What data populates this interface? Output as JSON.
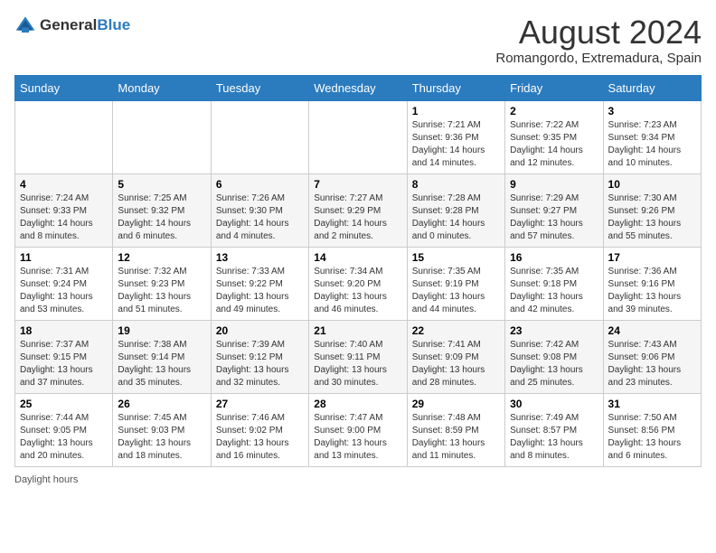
{
  "header": {
    "logo_general": "General",
    "logo_blue": "Blue",
    "main_title": "August 2024",
    "subtitle": "Romangordo, Extremadura, Spain"
  },
  "calendar": {
    "weekdays": [
      "Sunday",
      "Monday",
      "Tuesday",
      "Wednesday",
      "Thursday",
      "Friday",
      "Saturday"
    ],
    "weeks": [
      [
        {
          "day": "",
          "info": ""
        },
        {
          "day": "",
          "info": ""
        },
        {
          "day": "",
          "info": ""
        },
        {
          "day": "",
          "info": ""
        },
        {
          "day": "1",
          "info": "Sunrise: 7:21 AM\nSunset: 9:36 PM\nDaylight: 14 hours and 14 minutes."
        },
        {
          "day": "2",
          "info": "Sunrise: 7:22 AM\nSunset: 9:35 PM\nDaylight: 14 hours and 12 minutes."
        },
        {
          "day": "3",
          "info": "Sunrise: 7:23 AM\nSunset: 9:34 PM\nDaylight: 14 hours and 10 minutes."
        }
      ],
      [
        {
          "day": "4",
          "info": "Sunrise: 7:24 AM\nSunset: 9:33 PM\nDaylight: 14 hours and 8 minutes."
        },
        {
          "day": "5",
          "info": "Sunrise: 7:25 AM\nSunset: 9:32 PM\nDaylight: 14 hours and 6 minutes."
        },
        {
          "day": "6",
          "info": "Sunrise: 7:26 AM\nSunset: 9:30 PM\nDaylight: 14 hours and 4 minutes."
        },
        {
          "day": "7",
          "info": "Sunrise: 7:27 AM\nSunset: 9:29 PM\nDaylight: 14 hours and 2 minutes."
        },
        {
          "day": "8",
          "info": "Sunrise: 7:28 AM\nSunset: 9:28 PM\nDaylight: 14 hours and 0 minutes."
        },
        {
          "day": "9",
          "info": "Sunrise: 7:29 AM\nSunset: 9:27 PM\nDaylight: 13 hours and 57 minutes."
        },
        {
          "day": "10",
          "info": "Sunrise: 7:30 AM\nSunset: 9:26 PM\nDaylight: 13 hours and 55 minutes."
        }
      ],
      [
        {
          "day": "11",
          "info": "Sunrise: 7:31 AM\nSunset: 9:24 PM\nDaylight: 13 hours and 53 minutes."
        },
        {
          "day": "12",
          "info": "Sunrise: 7:32 AM\nSunset: 9:23 PM\nDaylight: 13 hours and 51 minutes."
        },
        {
          "day": "13",
          "info": "Sunrise: 7:33 AM\nSunset: 9:22 PM\nDaylight: 13 hours and 49 minutes."
        },
        {
          "day": "14",
          "info": "Sunrise: 7:34 AM\nSunset: 9:20 PM\nDaylight: 13 hours and 46 minutes."
        },
        {
          "day": "15",
          "info": "Sunrise: 7:35 AM\nSunset: 9:19 PM\nDaylight: 13 hours and 44 minutes."
        },
        {
          "day": "16",
          "info": "Sunrise: 7:35 AM\nSunset: 9:18 PM\nDaylight: 13 hours and 42 minutes."
        },
        {
          "day": "17",
          "info": "Sunrise: 7:36 AM\nSunset: 9:16 PM\nDaylight: 13 hours and 39 minutes."
        }
      ],
      [
        {
          "day": "18",
          "info": "Sunrise: 7:37 AM\nSunset: 9:15 PM\nDaylight: 13 hours and 37 minutes."
        },
        {
          "day": "19",
          "info": "Sunrise: 7:38 AM\nSunset: 9:14 PM\nDaylight: 13 hours and 35 minutes."
        },
        {
          "day": "20",
          "info": "Sunrise: 7:39 AM\nSunset: 9:12 PM\nDaylight: 13 hours and 32 minutes."
        },
        {
          "day": "21",
          "info": "Sunrise: 7:40 AM\nSunset: 9:11 PM\nDaylight: 13 hours and 30 minutes."
        },
        {
          "day": "22",
          "info": "Sunrise: 7:41 AM\nSunset: 9:09 PM\nDaylight: 13 hours and 28 minutes."
        },
        {
          "day": "23",
          "info": "Sunrise: 7:42 AM\nSunset: 9:08 PM\nDaylight: 13 hours and 25 minutes."
        },
        {
          "day": "24",
          "info": "Sunrise: 7:43 AM\nSunset: 9:06 PM\nDaylight: 13 hours and 23 minutes."
        }
      ],
      [
        {
          "day": "25",
          "info": "Sunrise: 7:44 AM\nSunset: 9:05 PM\nDaylight: 13 hours and 20 minutes."
        },
        {
          "day": "26",
          "info": "Sunrise: 7:45 AM\nSunset: 9:03 PM\nDaylight: 13 hours and 18 minutes."
        },
        {
          "day": "27",
          "info": "Sunrise: 7:46 AM\nSunset: 9:02 PM\nDaylight: 13 hours and 16 minutes."
        },
        {
          "day": "28",
          "info": "Sunrise: 7:47 AM\nSunset: 9:00 PM\nDaylight: 13 hours and 13 minutes."
        },
        {
          "day": "29",
          "info": "Sunrise: 7:48 AM\nSunset: 8:59 PM\nDaylight: 13 hours and 11 minutes."
        },
        {
          "day": "30",
          "info": "Sunrise: 7:49 AM\nSunset: 8:57 PM\nDaylight: 13 hours and 8 minutes."
        },
        {
          "day": "31",
          "info": "Sunrise: 7:50 AM\nSunset: 8:56 PM\nDaylight: 13 hours and 6 minutes."
        }
      ]
    ]
  },
  "footer": {
    "daylight_label": "Daylight hours"
  }
}
